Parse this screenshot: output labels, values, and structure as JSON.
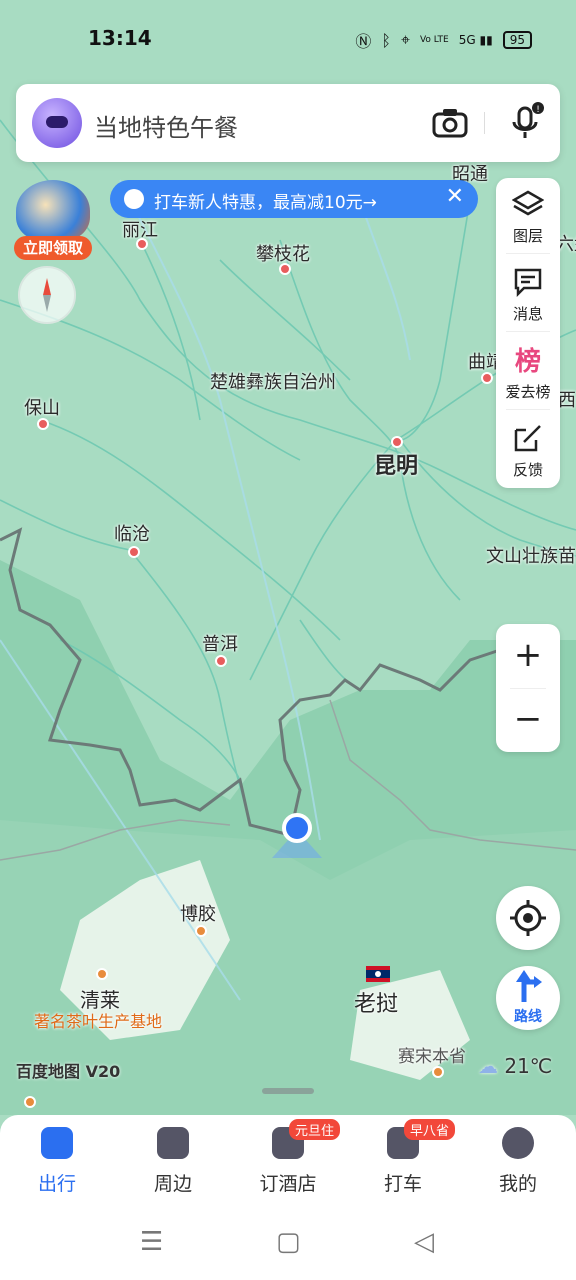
{
  "status_bar": {
    "time": "13:14",
    "icons": [
      "nfc-icon",
      "bluetooth-icon",
      "location-icon",
      "volte-icon",
      "5g-signal-icon"
    ],
    "volte": "Vo LTE",
    "network": "5G",
    "battery": "95"
  },
  "search": {
    "placeholder": "当地特色午餐"
  },
  "promo": {
    "text": "打车新人特惠，最高减10元→",
    "close": "✕"
  },
  "game_badge": {
    "label": "立即领取"
  },
  "tools": [
    {
      "icon": "layers-icon",
      "label": "图层"
    },
    {
      "icon": "message-icon",
      "label": "消息"
    },
    {
      "icon": "ranking-icon",
      "label": "爱去榜"
    },
    {
      "icon": "feedback-icon",
      "label": "反馈"
    }
  ],
  "zoom": {
    "in": "+",
    "out": "−"
  },
  "route": {
    "label": "路线"
  },
  "map_labels": {
    "lijiang": "丽江",
    "panzhihua": "攀枝花",
    "zhaotong": "昭通",
    "chuxiong": "楚雄彝族自治州",
    "qujing": "曲靖",
    "baoshan": "保山",
    "kunming": "昆明",
    "lincang": "临沧",
    "wenshan": "文山壮族苗",
    "puer": "普洱",
    "bojiao": "博胶",
    "laos": "老挝",
    "qinglai": "清莱",
    "tea_base": "著名茶叶生产基地",
    "saisong": "赛宋本省",
    "edge_right_1": "六盘",
    "edge_right_2": "西"
  },
  "watermark": "百度地图 V20",
  "weather": {
    "temp": "21℃"
  },
  "bottom_nav": [
    {
      "label": "出行",
      "badge": "",
      "active": true
    },
    {
      "label": "周边",
      "badge": "",
      "active": false
    },
    {
      "label": "订酒店",
      "badge": "元旦住",
      "active": false
    },
    {
      "label": "打车",
      "badge": "早八省",
      "active": false
    },
    {
      "label": "我的",
      "badge": "",
      "active": false
    }
  ],
  "system_nav": {
    "menu": "☰",
    "home": "▢",
    "back": "◁"
  }
}
